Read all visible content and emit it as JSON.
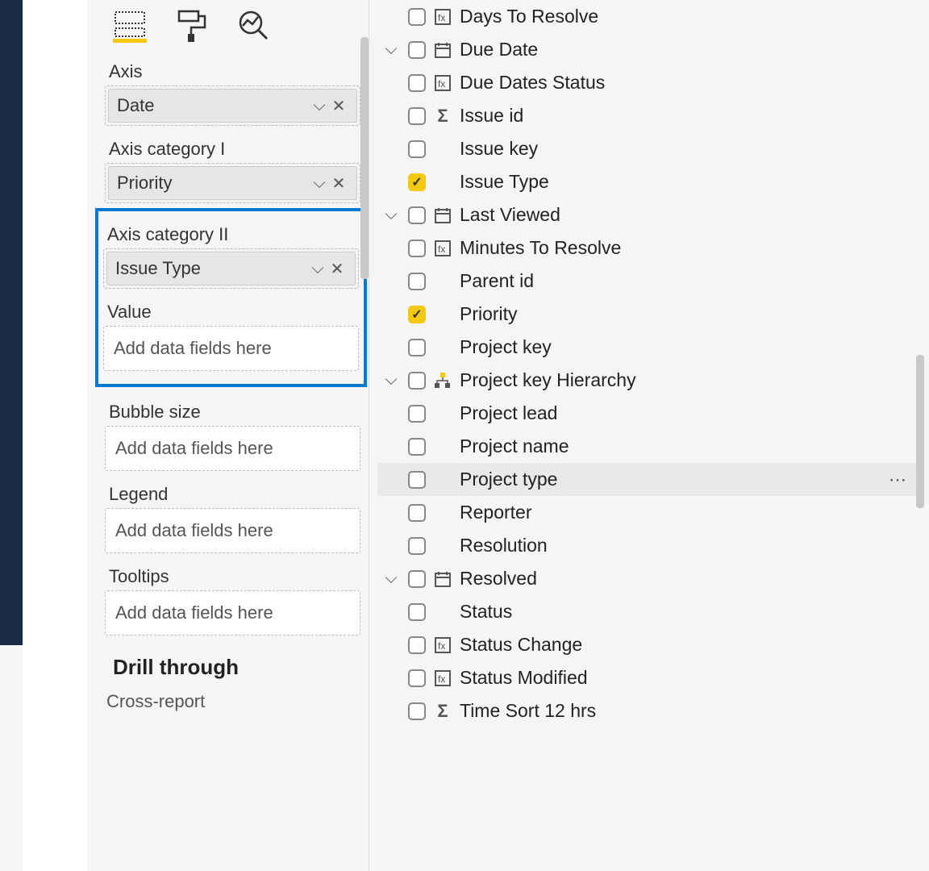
{
  "visualPanel": {
    "wells": {
      "axis": {
        "label": "Axis",
        "field": "Date"
      },
      "axisCat1": {
        "label": "Axis category I",
        "field": "Priority"
      },
      "axisCat2": {
        "label": "Axis category II",
        "field": "Issue Type"
      },
      "value": {
        "label": "Value",
        "placeholder": "Add data fields here"
      },
      "bubbleSize": {
        "label": "Bubble size",
        "placeholder": "Add data fields here"
      },
      "legend": {
        "label": "Legend",
        "placeholder": "Add data fields here"
      },
      "tooltips": {
        "label": "Tooltips",
        "placeholder": "Add data fields here"
      }
    },
    "drillThrough": {
      "heading": "Drill through",
      "crossReport": "Cross-report"
    }
  },
  "fields": [
    {
      "label": "Days To Resolve",
      "checked": false,
      "icon": "calc",
      "expandable": false
    },
    {
      "label": "Due Date",
      "checked": false,
      "icon": "calendar",
      "expandable": true
    },
    {
      "label": "Due Dates Status",
      "checked": false,
      "icon": "calc",
      "expandable": false
    },
    {
      "label": "Issue id",
      "checked": false,
      "icon": "sigma",
      "expandable": false
    },
    {
      "label": "Issue key",
      "checked": false,
      "icon": "",
      "expandable": false
    },
    {
      "label": "Issue Type",
      "checked": true,
      "icon": "",
      "expandable": false
    },
    {
      "label": "Last Viewed",
      "checked": false,
      "icon": "calendar",
      "expandable": true
    },
    {
      "label": "Minutes To Resolve",
      "checked": false,
      "icon": "calc",
      "expandable": false
    },
    {
      "label": "Parent id",
      "checked": false,
      "icon": "",
      "expandable": false
    },
    {
      "label": "Priority",
      "checked": true,
      "icon": "",
      "expandable": false
    },
    {
      "label": "Project key",
      "checked": false,
      "icon": "",
      "expandable": false
    },
    {
      "label": "Project key Hierarchy",
      "checked": false,
      "icon": "hierarchy",
      "expandable": true
    },
    {
      "label": "Project lead",
      "checked": false,
      "icon": "",
      "expandable": false
    },
    {
      "label": "Project name",
      "checked": false,
      "icon": "",
      "expandable": false
    },
    {
      "label": "Project type",
      "checked": false,
      "icon": "",
      "expandable": false,
      "hovered": true
    },
    {
      "label": "Reporter",
      "checked": false,
      "icon": "",
      "expandable": false
    },
    {
      "label": "Resolution",
      "checked": false,
      "icon": "",
      "expandable": false
    },
    {
      "label": "Resolved",
      "checked": false,
      "icon": "calendar",
      "expandable": true
    },
    {
      "label": "Status",
      "checked": false,
      "icon": "",
      "expandable": false
    },
    {
      "label": "Status Change",
      "checked": false,
      "icon": "calc",
      "expandable": false
    },
    {
      "label": "Status Modified",
      "checked": false,
      "icon": "calc",
      "expandable": false
    },
    {
      "label": "Time Sort 12 hrs",
      "checked": false,
      "icon": "sigma",
      "expandable": false
    }
  ]
}
